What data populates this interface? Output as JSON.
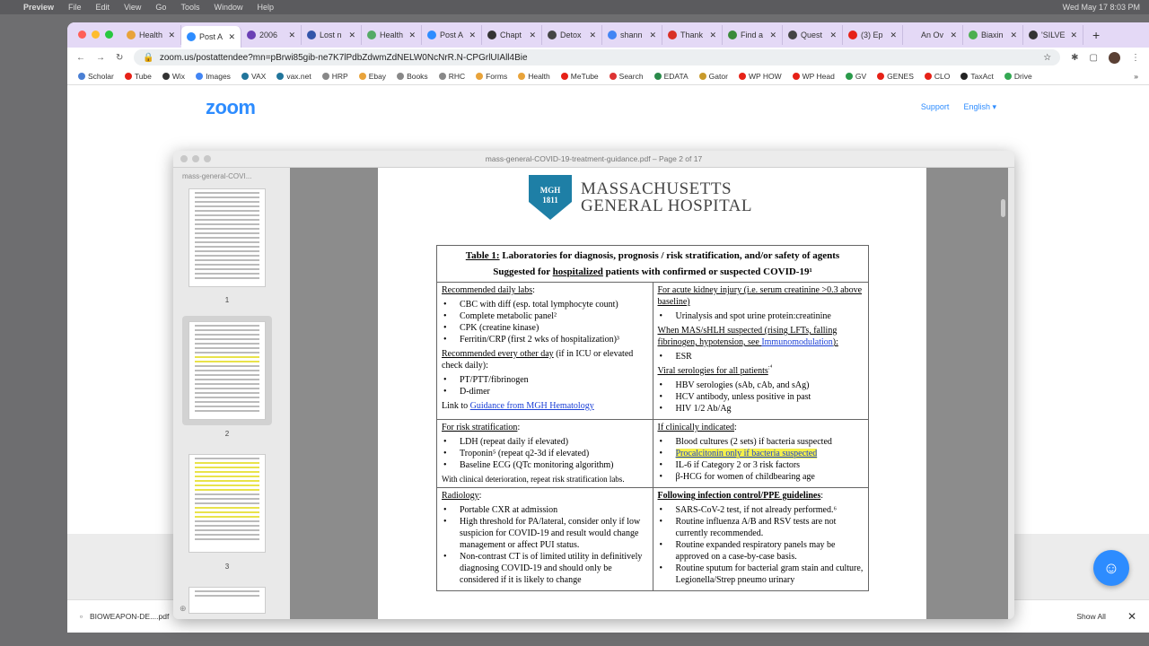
{
  "menubar": {
    "app": "Preview",
    "items": [
      "File",
      "Edit",
      "View",
      "Go",
      "Tools",
      "Window",
      "Help"
    ],
    "clock": "Wed May 17  8:03 PM"
  },
  "tabs": [
    {
      "label": "Health",
      "color": "#e8a33a"
    },
    {
      "label": "Post A",
      "color": "#2d8cff",
      "active": true
    },
    {
      "label": "2006",
      "color": "#6a3fb5"
    },
    {
      "label": "Lost n",
      "color": "#3355aa"
    },
    {
      "label": "Health",
      "color": "#55aa66"
    },
    {
      "label": "Post A",
      "color": "#2d8cff"
    },
    {
      "label": "Chapt",
      "color": "#333333"
    },
    {
      "label": "Detox",
      "color": "#444444"
    },
    {
      "label": "shann",
      "color": "#4285f4"
    },
    {
      "label": "Thank",
      "color": "#d93025"
    },
    {
      "label": "Find a",
      "color": "#3a8a3a"
    },
    {
      "label": "Quest",
      "color": "#444444"
    },
    {
      "label": "(3) Ep",
      "color": "#e62117"
    },
    {
      "label": "An Ov",
      "color": "#e4d9f6"
    },
    {
      "label": "Biaxin",
      "color": "#4caf50"
    },
    {
      "label": "'SILVE",
      "color": "#333333"
    }
  ],
  "address": {
    "url": "zoom.us/postattendee?mn=pBrwi85gib-ne7K7lPdbZdwmZdNELW0NcNrR.N-CPGrlUIAll4Bie"
  },
  "bookmarks": [
    "Scholar",
    "Tube",
    "Wix",
    "Images",
    "VAX",
    "vax.net",
    "HRP",
    "Ebay",
    "Books",
    "RHC",
    "Forms",
    "Health",
    "MeTube",
    "Search",
    "EDATA",
    "Gator",
    "WP HOW",
    "WP Head",
    "GV",
    "GENES",
    "CLO",
    "TaxAct",
    "Drive"
  ],
  "zoom": {
    "logo": "zoom",
    "support": "Support",
    "language": "English"
  },
  "preview": {
    "title": "mass-general-COVID-19-treatment-guidance.pdf – Page 2 of 17",
    "sidebar_title": "mass-general-COVI...",
    "pages": [
      "1",
      "2",
      "3"
    ]
  },
  "doc": {
    "logo_seal": "MGH 1811",
    "hospital_line1": "MASSACHUSETTS",
    "hospital_line2": "GENERAL HOSPITAL",
    "table_label": "Table 1:",
    "title1": " Laboratories for diagnosis, prognosis / risk stratification, and/or safety of agents",
    "title2a": "Suggested for ",
    "title2b": "hospitalized",
    "title2c": " patients with confirmed or suspected COVID-19¹",
    "daily_head": "Recommended daily labs",
    "daily": [
      "CBC with diff (esp. total lymphocyte count)",
      "Complete metabolic panel²",
      "CPK (creatine kinase)",
      "Ferritin/CRP (first 2 wks of hospitalization)³"
    ],
    "eod_head": "Recommended every other day",
    "eod_tail": " (if in ICU or elevated check daily):",
    "eod": [
      "PT/PTT/fibrinogen",
      "D-dimer"
    ],
    "link_pre": "Link to ",
    "link": "Guidance from MGH Hematology",
    "aki_head": "For acute kidney injury (i.e. serum creatinine >0.3 above baseline)",
    "aki": [
      "Urinalysis and spot urine protein:creatinine"
    ],
    "mas_head": "When MAS/sHLH suspected (rising LFTs, falling fibrinogen, hypotension, see ",
    "mas_link": "Immunomodulation",
    "mas_tail": "):",
    "mas": [
      "ESR"
    ],
    "viral_head": "Viral serologies for all patients",
    "viral_sup": ":⁴",
    "viral": [
      "HBV serologies (sAb, cAb, and sAg)",
      "HCV antibody, unless positive in past",
      "HIV 1/2 Ab/Ag"
    ],
    "risk_head": "For risk stratification",
    "risk": [
      "LDH (repeat daily if elevated)",
      "Troponin⁵ (repeat q2-3d if elevated)",
      "Baseline ECG (QTc monitoring algorithm)"
    ],
    "risk_note": "With clinical deterioration, repeat risk stratification labs.",
    "clin_head": "If clinically indicated",
    "clin1": "Blood cultures (2 sets) if bacteria suspected",
    "clin_hl": "Procalcitonin only if bacteria suspected",
    "clin3": "IL-6 if Category 2 or 3 risk factors",
    "clin4": "β-HCG for women of childbearing age",
    "rad_head": "Radiology",
    "rad": [
      "Portable CXR at admission",
      "High threshold for PA/lateral, consider only if low suspicion for COVID-19 and result would change management or affect PUI status.",
      "Non-contrast CT is of limited utility in definitively diagnosing COVID-19 and should only be considered if it is likely to change"
    ],
    "ppe_head": "Following infection control/PPE guidelines",
    "ppe": [
      "SARS-CoV-2 test, if not already performed.⁶",
      "Routine influenza A/B and RSV tests are not currently recommended.",
      "Routine expanded respiratory panels may be approved on a case-by-case basis.",
      "Routine sputum for bacterial gram stain and culture, Legionella/Strep pneumo urinary"
    ]
  },
  "downloads": {
    "file": "BIOWEAPON-DE....pdf",
    "show_all": "Show All"
  }
}
